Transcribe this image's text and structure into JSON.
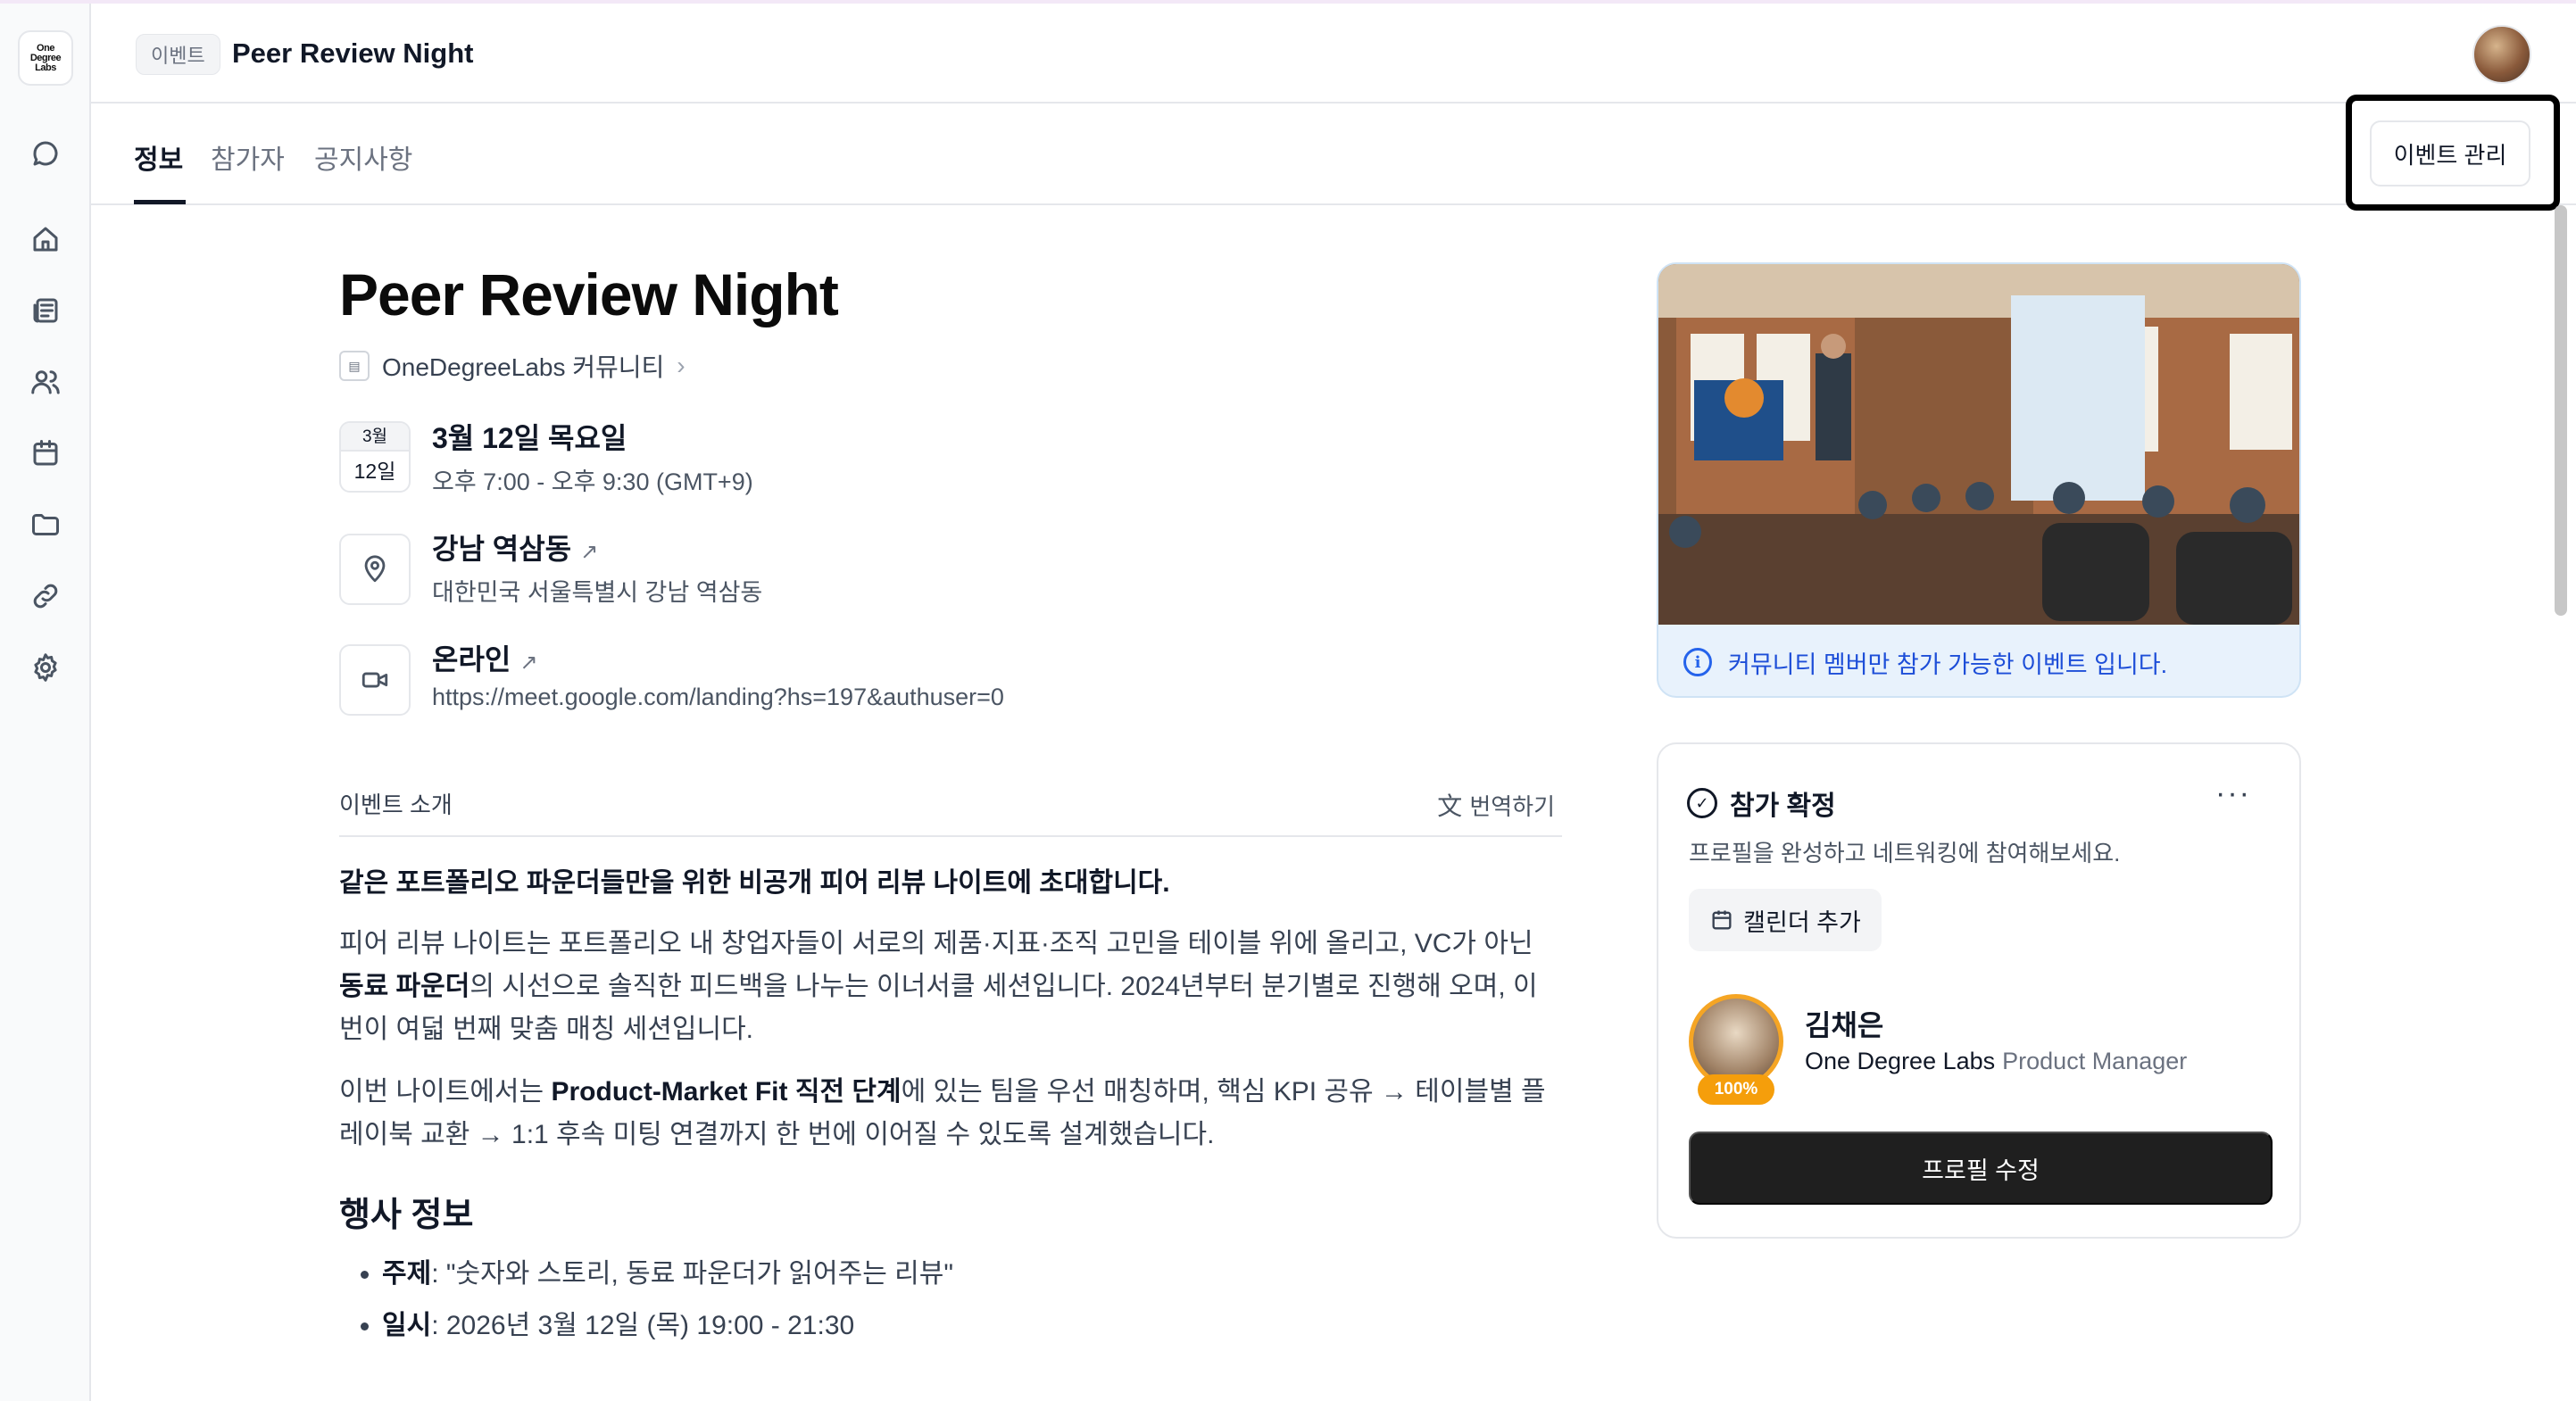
{
  "app": {
    "logo_text": "One Degree Labs"
  },
  "sidebar": {
    "items": [
      {
        "name": "chat",
        "icon": "chat-bubble-icon"
      },
      {
        "name": "home",
        "icon": "home-icon"
      },
      {
        "name": "posts",
        "icon": "newspaper-icon"
      },
      {
        "name": "members",
        "icon": "users-icon"
      },
      {
        "name": "calendar",
        "icon": "calendar-icon"
      },
      {
        "name": "files",
        "icon": "folder-icon"
      },
      {
        "name": "links",
        "icon": "link-icon"
      },
      {
        "name": "settings",
        "icon": "gear-icon"
      }
    ]
  },
  "header": {
    "breadcrumb": "이벤트",
    "title": "Peer Review Night"
  },
  "tabs": [
    {
      "label": "정보",
      "active": true
    },
    {
      "label": "참가자",
      "active": false
    },
    {
      "label": "공지사항",
      "active": false
    }
  ],
  "manage_button": "이벤트 관리",
  "event": {
    "title": "Peer Review Night",
    "community": "OneDegreeLabs 커뮤니티",
    "date_month": "3월",
    "date_day": "12일",
    "date_full": "3월 12일 목요일",
    "time": "오후 7:00 - 오후 9:30 (GMT+9)",
    "location_name": "강남 역삼동",
    "location_address": "대한민국 서울특별시 강남 역삼동",
    "online_label": "온라인",
    "online_url": "https://meet.google.com/landing?hs=197&authuser=0"
  },
  "intro": {
    "label": "이벤트 소개",
    "translate": "번역하기",
    "lead": "같은 포트폴리오 파운더들만을 위한 비공개 피어 리뷰 나이트에 초대합니다.",
    "para1_a": "피어 리뷰 나이트는 포트폴리오 내 창업자들이 서로의 제품·지표·조직 고민을 테이블 위에 올리고, VC가 아닌 ",
    "para1_bold": "동료 파운더",
    "para1_b": "의 시선으로 솔직한 피드백을 나누는 이너서클 세션입니다. 2024년부터 분기별로 진행해 오며, 이번이 여덟 번째 맞춤 매칭 세션입니다.",
    "para2_a": "이번 나이트에서는 ",
    "para2_bold": "Product-Market Fit 직전 단계",
    "para2_b": "에 있는 팀을 우선 매칭하며, 핵심 KPI 공유 → 테이블별 플레이북 교환 → 1:1 후속 미팅 연결까지 한 번에 이어질 수 있도록 설계했습니다.",
    "section_title": "행사 정보",
    "bullets": [
      {
        "key": "주제",
        "value": ": \"숫자와 스토리, 동료 파운더가 읽어주는 리뷰\""
      },
      {
        "key": "일시",
        "value": ": 2026년 3월 12일 (목) 19:00 - 21:30"
      }
    ]
  },
  "hero": {
    "notice": "커뮤니티 멤버만 참가 가능한 이벤트 입니다."
  },
  "rsvp": {
    "title": "참가 확정",
    "subtitle": "프로필을 완성하고 네트워킹에 참여해보세요.",
    "calendar_button": "캘린더 추가",
    "profile_name": "김채은",
    "profile_org": "One Degree Labs",
    "profile_role": "Product Manager",
    "profile_completion": "100%",
    "edit_button": "프로필 수정"
  },
  "colors": {
    "accent_blue": "#2563eb",
    "notice_bg": "#e8f2fc",
    "progress_orange": "#f59e0b",
    "primary_dark": "#1f1f1f"
  }
}
